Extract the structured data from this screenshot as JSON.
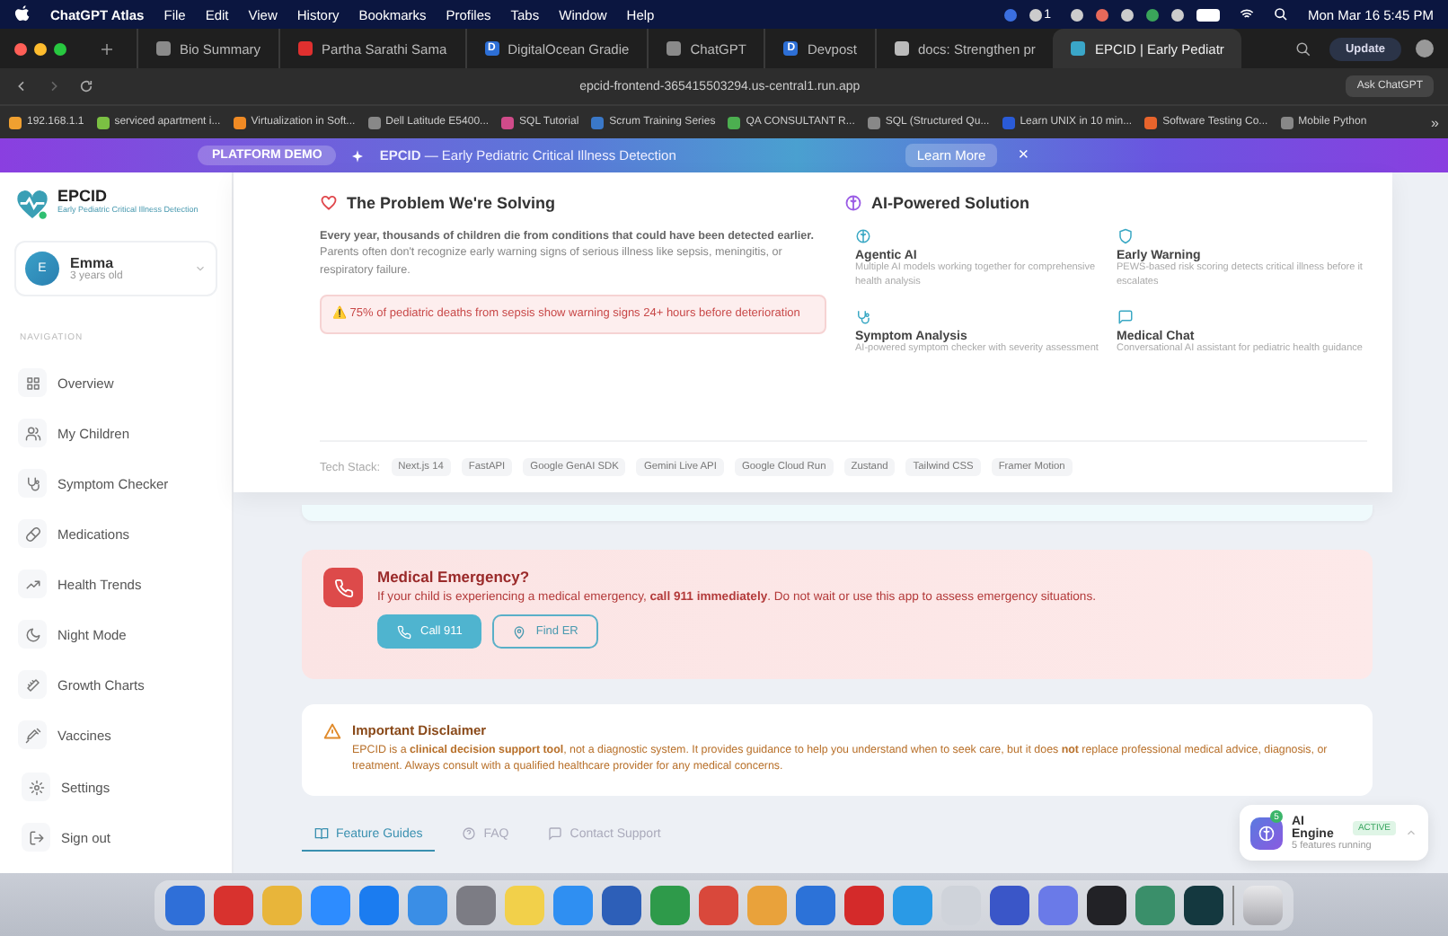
{
  "menu_bar": {
    "app": "ChatGPT Atlas",
    "items": [
      "File",
      "Edit",
      "View",
      "History",
      "Bookmarks",
      "Profiles",
      "Tabs",
      "Window",
      "Help"
    ],
    "notification_count": "1",
    "clock": "Mon Mar 16  5:45 PM"
  },
  "browser": {
    "tabs": [
      {
        "label": "Bio Summary",
        "selected": false
      },
      {
        "label": "Partha Sarathi Sama",
        "selected": false
      },
      {
        "label": "DigitalOcean Gradie",
        "badge": "D",
        "selected": false
      },
      {
        "label": "ChatGPT",
        "selected": false
      },
      {
        "label": "Devpost",
        "badge": "D",
        "selected": false
      },
      {
        "label": "docs: Strengthen pr",
        "selected": false
      },
      {
        "label": "EPCID | Early Pediatr",
        "selected": true
      }
    ],
    "update_button": "Update",
    "url": "epcid-frontend-365415503294.us-central1.run.app",
    "ask_button": "Ask ChatGPT",
    "bookmarks": [
      "192.168.1.1",
      "serviced apartment i...",
      "Virtualization in Soft...",
      "Dell Latitude E5400...",
      "SQL Tutorial",
      "Scrum Training Series",
      "QA CONSULTANT R...",
      "SQL (Structured Qu...",
      "Learn UNIX in 10 min...",
      "Software Testing Co...",
      "Mobile Python"
    ],
    "more": "»"
  },
  "banner": {
    "badge": "PLATFORM DEMO",
    "text": "**EPCID** — Early Pediatric Critical Illness Detection",
    "learn_more": "Learn More",
    "close": "×"
  },
  "sidebar": {
    "logo_title": "EPCID",
    "logo_subtitle": "Early Pediatric Critical Illness Detection",
    "profile": {
      "initial": "E",
      "name": "Emma",
      "age": "3 years old"
    },
    "section": "NAVIGATION",
    "items": [
      {
        "label": "Overview",
        "selected": false
      },
      {
        "label": "My Children",
        "selected": false
      },
      {
        "label": "Symptom Checker",
        "selected": false
      },
      {
        "label": "Medications",
        "selected": false
      },
      {
        "label": "Health Trends",
        "selected": false
      },
      {
        "label": "Night Mode",
        "selected": false
      },
      {
        "label": "Growth Charts",
        "selected": false
      },
      {
        "label": "Vaccines",
        "selected": false
      }
    ],
    "footer": [
      "Settings",
      "Sign out"
    ]
  },
  "about_panel": {
    "problem": {
      "title": "The Problem We're Solving",
      "text": "**Every year, thousands of children die from conditions that could have been detected earlier.** Parents often don't recognize early warning signs of serious illness like sepsis, meningitis, or respiratory failure.",
      "alert": "⚠️ 75% of pediatric deaths from sepsis show warning signs 24+ hours before deterioration"
    },
    "solution": {
      "title": "AI-Powered Solution",
      "features": [
        {
          "title": "Agentic AI",
          "text": "Multiple AI models working together for comprehensive health analysis"
        },
        {
          "title": "Early Warning",
          "text": "PEWS-based risk scoring detects critical illness before it escalates"
        },
        {
          "title": "Symptom Analysis",
          "text": "AI-powered symptom checker with severity assessment"
        },
        {
          "title": "Medical Chat",
          "text": "Conversational AI assistant for pediatric health guidance"
        }
      ]
    },
    "tech_label": "Tech Stack:",
    "tech": [
      "Next.js 14",
      "FastAPI",
      "Google GenAI SDK",
      "Gemini Live API",
      "Google Cloud Run",
      "Zustand",
      "Tailwind CSS",
      "Framer Motion"
    ]
  },
  "emergency": {
    "title": "Medical Emergency?",
    "text": "If your child is experiencing a medical emergency, **call 911 immediately**. Do not wait or use this app to assess emergency situations.",
    "buttons": [
      "Call 911",
      "Find ER"
    ]
  },
  "disclaimer": {
    "title": "Important Disclaimer",
    "text": "EPCID is a **clinical decision support tool**, not a diagnostic system. It provides guidance to help you understand when to seek care, but it does **not** replace professional medical advice, diagnosis, or treatment. Always consult with a qualified healthcare provider for any medical concerns."
  },
  "help_tabs": [
    {
      "label": "Feature Guides",
      "selected": true
    },
    {
      "label": "FAQ",
      "selected": false
    },
    {
      "label": "Contact Support",
      "selected": false
    }
  ],
  "ai_widget": {
    "count": "5",
    "title": "AI Engine",
    "status": "ACTIVE",
    "subtitle": "5 features running"
  }
}
